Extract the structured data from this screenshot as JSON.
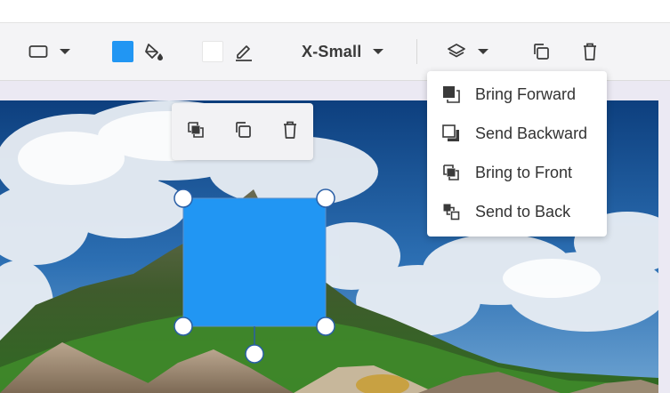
{
  "toolbar": {
    "shape_icon": "rectangle-icon",
    "fill_color": "#2196f3",
    "stroke_color": "#ffffff",
    "font_size_label": "X-Small",
    "layer_icon": "layers-icon",
    "duplicate_icon": "duplicate-icon",
    "delete_icon": "trash-icon"
  },
  "floating_toolbar": {
    "items": [
      {
        "icon": "bring-to-front-icon"
      },
      {
        "icon": "duplicate-icon"
      },
      {
        "icon": "trash-icon"
      }
    ]
  },
  "layer_menu": {
    "items": [
      {
        "label": "Bring Forward",
        "icon": "bring-forward-icon"
      },
      {
        "label": "Send Backward",
        "icon": "send-backward-icon"
      },
      {
        "label": "Bring to Front",
        "icon": "bring-to-front-icon"
      },
      {
        "label": "Send to Back",
        "icon": "send-to-back-icon"
      }
    ]
  },
  "selected_shape": {
    "type": "rectangle",
    "fill": "#2196f3"
  },
  "colors": {
    "accent": "#2196f3",
    "toolbar_bg": "#f4f4f6",
    "canvas_bg": "#ebe9f3"
  }
}
